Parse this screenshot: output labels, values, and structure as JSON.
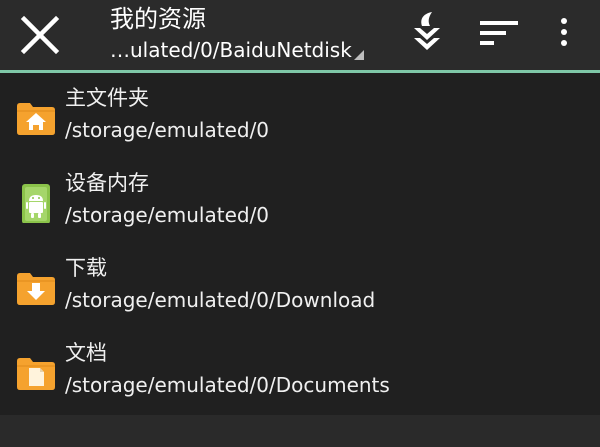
{
  "header": {
    "title": "我的资源",
    "path": "…ulated/0/BaiduNetdisk",
    "close_icon": "close-icon",
    "actions": [
      "swipe-down-icon",
      "sort-icon",
      "more-vertical-icon"
    ]
  },
  "colors": {
    "background": "#202020",
    "toolbar": "#2b2b2b",
    "accent_line": "#7fc8a8",
    "folder_orange": "#f5a22e",
    "android_green": "#8bc34a"
  },
  "items": [
    {
      "icon": "home-folder-icon",
      "name": "主文件夹",
      "path": "/storage/emulated/0"
    },
    {
      "icon": "android-storage-icon",
      "name": "设备内存",
      "path": "/storage/emulated/0"
    },
    {
      "icon": "download-folder-icon",
      "name": "下载",
      "path": "/storage/emulated/0/Download"
    },
    {
      "icon": "documents-folder-icon",
      "name": "文档",
      "path": "/storage/emulated/0/Documents"
    }
  ]
}
